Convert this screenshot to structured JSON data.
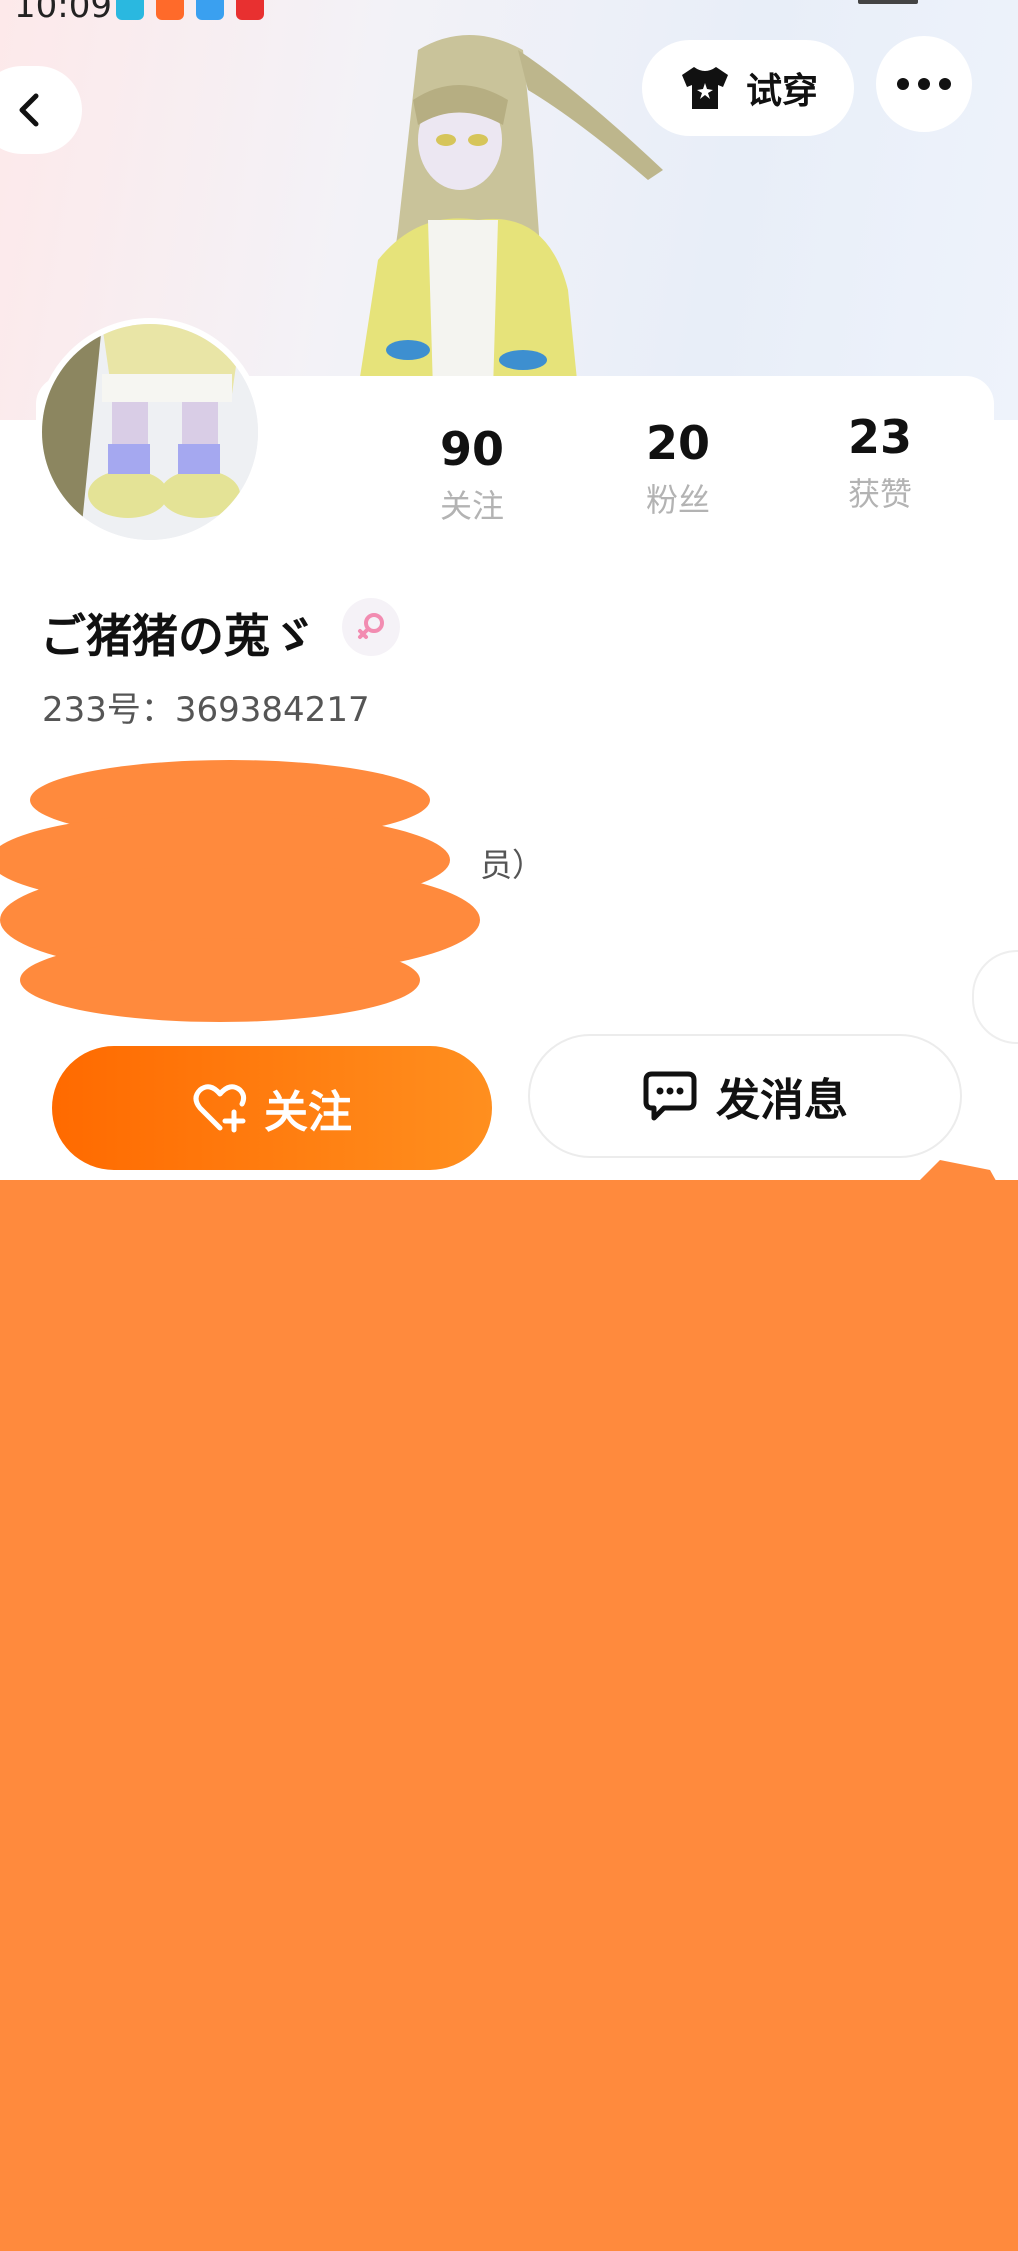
{
  "status_bar": {
    "time": "10:09"
  },
  "header": {
    "try_on_label": "试穿"
  },
  "profile": {
    "username": "ご猪猪の莵ゞ",
    "uid_line": "233号：369384217",
    "bio_fragment": "员）",
    "stats": [
      {
        "value": "90",
        "label": "关注"
      },
      {
        "value": "20",
        "label": "粉丝"
      },
      {
        "value": "23",
        "label": "获赞"
      }
    ]
  },
  "actions": {
    "follow_label": "关注",
    "message_label": "发消息"
  },
  "colors": {
    "accent_orange": "#ff6a00",
    "redaction": "#ff8a3d",
    "gender_pink": "#f28cb1"
  }
}
